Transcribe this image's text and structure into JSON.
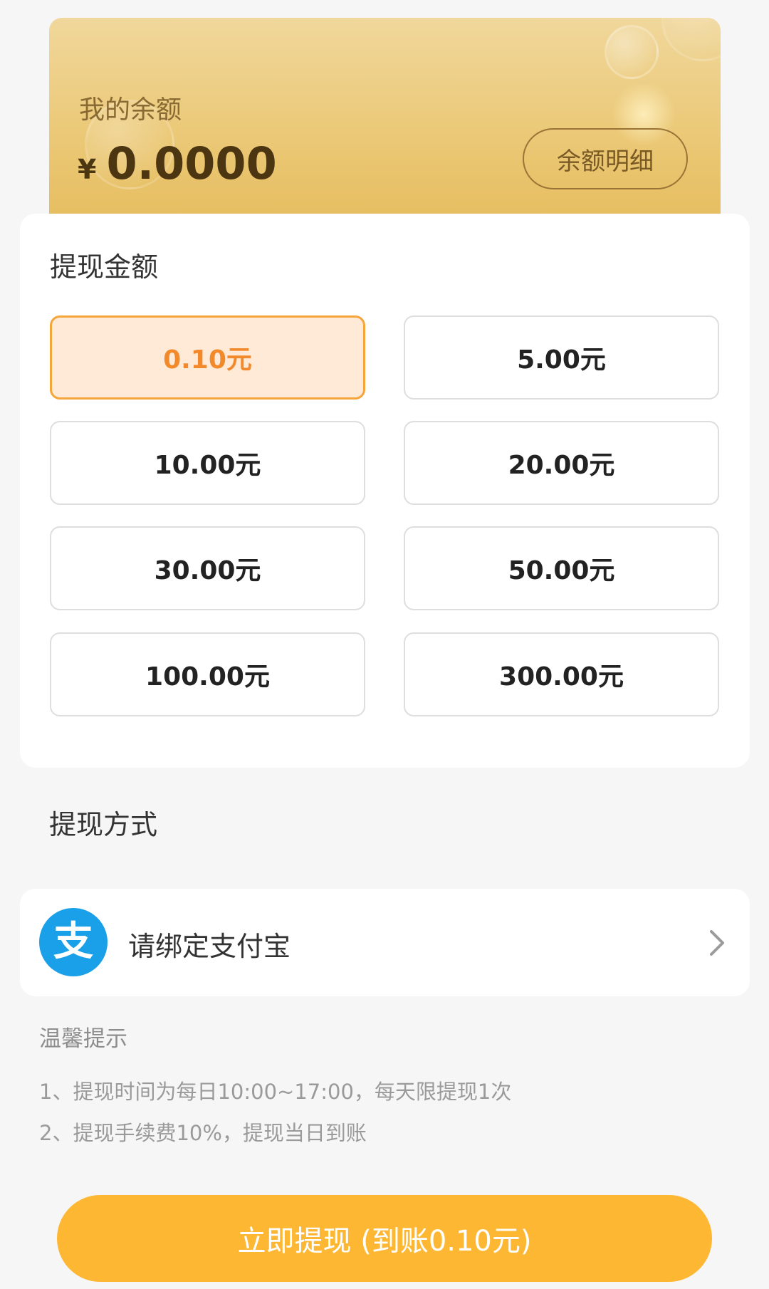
{
  "balance": {
    "label": "我的余额",
    "currency_symbol": "¥",
    "amount": "0.0000",
    "detail_button_label": "余额明细"
  },
  "amount_section": {
    "title": "提现金额",
    "selected_index": 0,
    "options": [
      "0.10元",
      "5.00元",
      "10.00元",
      "20.00元",
      "30.00元",
      "50.00元",
      "100.00元",
      "300.00元"
    ]
  },
  "method_section": {
    "title": "提现方式",
    "alipay_label": "请绑定支付宝",
    "alipay_icon_glyph": "支"
  },
  "tips": {
    "title": "温馨提示",
    "lines": [
      "1、提现时间为每日10:00~17:00，每天限提现1次",
      "2、提现手续费10%，提现当日到账"
    ]
  },
  "withdraw_button_label": "立即提现 (到账0.10元)",
  "colors": {
    "accent": "#fdb733",
    "selected_border": "#f5a53a",
    "selected_text": "#f28a2b",
    "alipay_blue": "#1aa0e8"
  }
}
